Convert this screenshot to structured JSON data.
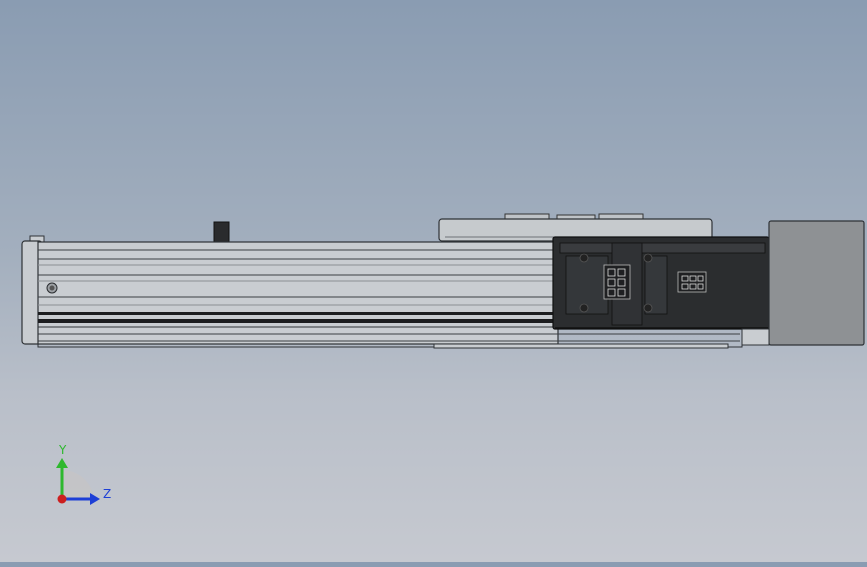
{
  "viewport": {
    "background_top": "#8a9cb2",
    "background_bottom": "#c6c9d0",
    "model": {
      "body_color": "#c9cdd1",
      "edge_color": "#2e3236",
      "slot_color": "#1c1d1f",
      "motor_color": "#8c8f92",
      "carriage_color": "#2a2c2e"
    },
    "triad": {
      "y_label": "Y",
      "z_label": "Z",
      "y_color": "#2eb82e",
      "z_color": "#1d3fd6",
      "origin_color": "#cc1f1f"
    }
  }
}
